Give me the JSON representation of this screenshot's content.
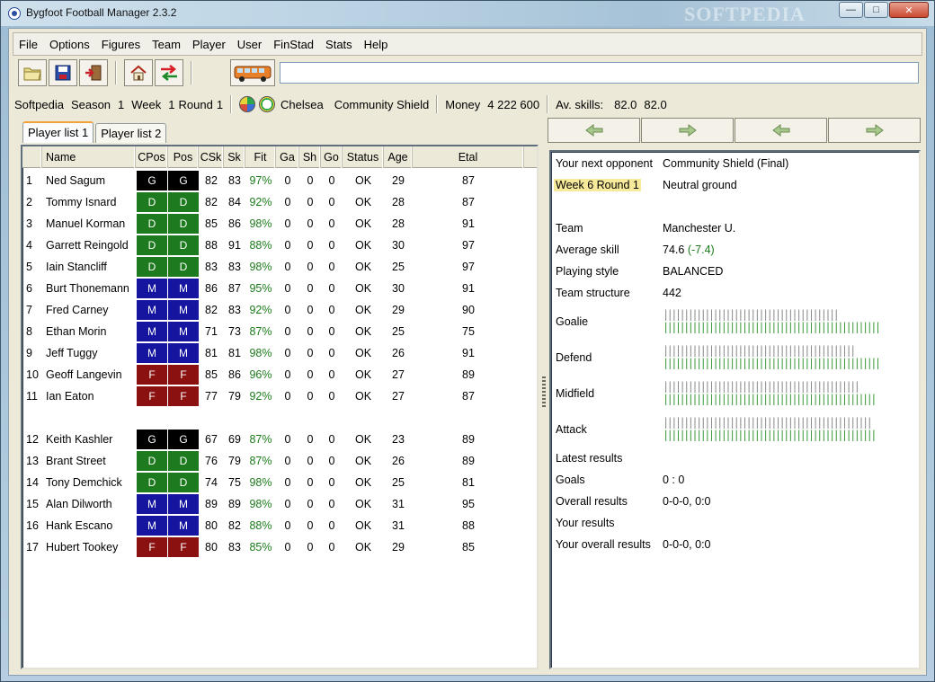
{
  "window": {
    "title": "Bygfoot Football Manager 2.3.2",
    "watermark": "SOFTPEDIA"
  },
  "menu": [
    "File",
    "Options",
    "Figures",
    "Team",
    "Player",
    "User",
    "FinStad",
    "Stats",
    "Help"
  ],
  "toolbar": {
    "icons": [
      "open-folder-icon",
      "save-disk-icon",
      "exit-door-icon",
      "home-icon",
      "transfer-arrows-icon",
      "bus-icon"
    ],
    "command_value": ""
  },
  "info": {
    "user": "Softpedia",
    "season_label": "Season",
    "season": "1",
    "week_label": "Week",
    "week": "1",
    "round_label": "Round",
    "round": "1",
    "team": "Chelsea",
    "competition": "Community Shield",
    "money_label": "Money",
    "money": "4 222 600",
    "avskills_label": "Av. skills:",
    "avskill1": "82.0",
    "avskill2": "82.0"
  },
  "tabs": [
    "Player list 1",
    "Player list 2"
  ],
  "columns": [
    "",
    "Name",
    "CPos",
    "Pos",
    "CSk",
    "Sk",
    "Fit",
    "Ga",
    "Sh",
    "Go",
    "Status",
    "Age",
    "Etal"
  ],
  "players": [
    {
      "n": "1",
      "name": "Ned Sagum",
      "cpos": "G",
      "pos": "G",
      "csk": "82",
      "sk": "83",
      "fit": "97%",
      "ga": "0",
      "sh": "0",
      "go": "0",
      "status": "OK",
      "age": "29",
      "etal": "87"
    },
    {
      "n": "2",
      "name": "Tommy Isnard",
      "cpos": "D",
      "pos": "D",
      "csk": "82",
      "sk": "84",
      "fit": "92%",
      "ga": "0",
      "sh": "0",
      "go": "0",
      "status": "OK",
      "age": "28",
      "etal": "87"
    },
    {
      "n": "3",
      "name": "Manuel Korman",
      "cpos": "D",
      "pos": "D",
      "csk": "85",
      "sk": "86",
      "fit": "98%",
      "ga": "0",
      "sh": "0",
      "go": "0",
      "status": "OK",
      "age": "28",
      "etal": "91"
    },
    {
      "n": "4",
      "name": "Garrett Reingold",
      "cpos": "D",
      "pos": "D",
      "csk": "88",
      "sk": "91",
      "fit": "88%",
      "ga": "0",
      "sh": "0",
      "go": "0",
      "status": "OK",
      "age": "30",
      "etal": "97"
    },
    {
      "n": "5",
      "name": "Iain Stancliff",
      "cpos": "D",
      "pos": "D",
      "csk": "83",
      "sk": "83",
      "fit": "98%",
      "ga": "0",
      "sh": "0",
      "go": "0",
      "status": "OK",
      "age": "25",
      "etal": "97"
    },
    {
      "n": "6",
      "name": "Burt Thonemann",
      "cpos": "M",
      "pos": "M",
      "csk": "86",
      "sk": "87",
      "fit": "95%",
      "ga": "0",
      "sh": "0",
      "go": "0",
      "status": "OK",
      "age": "30",
      "etal": "91"
    },
    {
      "n": "7",
      "name": "Fred Carney",
      "cpos": "M",
      "pos": "M",
      "csk": "82",
      "sk": "83",
      "fit": "92%",
      "ga": "0",
      "sh": "0",
      "go": "0",
      "status": "OK",
      "age": "29",
      "etal": "90"
    },
    {
      "n": "8",
      "name": "Ethan Morin",
      "cpos": "M",
      "pos": "M",
      "csk": "71",
      "sk": "73",
      "fit": "87%",
      "ga": "0",
      "sh": "0",
      "go": "0",
      "status": "OK",
      "age": "25",
      "etal": "75"
    },
    {
      "n": "9",
      "name": "Jeff Tuggy",
      "cpos": "M",
      "pos": "M",
      "csk": "81",
      "sk": "81",
      "fit": "98%",
      "ga": "0",
      "sh": "0",
      "go": "0",
      "status": "OK",
      "age": "26",
      "etal": "91"
    },
    {
      "n": "10",
      "name": "Geoff Langevin",
      "cpos": "F",
      "pos": "F",
      "csk": "85",
      "sk": "86",
      "fit": "96%",
      "ga": "0",
      "sh": "0",
      "go": "0",
      "status": "OK",
      "age": "27",
      "etal": "89"
    },
    {
      "n": "11",
      "name": "Ian Eaton",
      "cpos": "F",
      "pos": "F",
      "csk": "77",
      "sk": "79",
      "fit": "92%",
      "ga": "0",
      "sh": "0",
      "go": "0",
      "status": "OK",
      "age": "27",
      "etal": "87"
    },
    {
      "n": "12",
      "name": "Keith Kashler",
      "cpos": "G",
      "pos": "G",
      "csk": "67",
      "sk": "69",
      "fit": "87%",
      "ga": "0",
      "sh": "0",
      "go": "0",
      "status": "OK",
      "age": "23",
      "etal": "89"
    },
    {
      "n": "13",
      "name": "Brant Street",
      "cpos": "D",
      "pos": "D",
      "csk": "76",
      "sk": "79",
      "fit": "87%",
      "ga": "0",
      "sh": "0",
      "go": "0",
      "status": "OK",
      "age": "26",
      "etal": "89"
    },
    {
      "n": "14",
      "name": "Tony Demchick",
      "cpos": "D",
      "pos": "D",
      "csk": "74",
      "sk": "75",
      "fit": "98%",
      "ga": "0",
      "sh": "0",
      "go": "0",
      "status": "OK",
      "age": "25",
      "etal": "81"
    },
    {
      "n": "15",
      "name": "Alan Dilworth",
      "cpos": "M",
      "pos": "M",
      "csk": "89",
      "sk": "89",
      "fit": "98%",
      "ga": "0",
      "sh": "0",
      "go": "0",
      "status": "OK",
      "age": "31",
      "etal": "95"
    },
    {
      "n": "16",
      "name": "Hank Escano",
      "cpos": "M",
      "pos": "M",
      "csk": "80",
      "sk": "82",
      "fit": "88%",
      "ga": "0",
      "sh": "0",
      "go": "0",
      "status": "OK",
      "age": "31",
      "etal": "88"
    },
    {
      "n": "17",
      "name": "Hubert Tookey",
      "cpos": "F",
      "pos": "F",
      "csk": "80",
      "sk": "83",
      "fit": "85%",
      "ga": "0",
      "sh": "0",
      "go": "0",
      "status": "OK",
      "age": "29",
      "etal": "85"
    }
  ],
  "position_colors": {
    "G": "#000000",
    "D": "#1e7a1e",
    "M": "#1515a0",
    "F": "#8b1010"
  },
  "nav_icons": [
    "arrow-left-icon",
    "arrow-right-icon",
    "arrow-left-icon",
    "arrow-right-icon"
  ],
  "opponent": {
    "next_label": "Your next opponent",
    "next_value": "Community Shield (Final)",
    "week_round": "Week 6 Round 1",
    "venue": "Neutral ground",
    "team_label": "Team",
    "team": "Manchester U.",
    "avg_label": "Average skill",
    "avg_value": "74.6",
    "avg_diff": "(-7.4)",
    "style_label": "Playing style",
    "style": "BALANCED",
    "structure_label": "Team structure",
    "structure": "442",
    "goalie_label": "Goalie",
    "defend_label": "Defend",
    "midfield_label": "Midfield",
    "attack_label": "Attack",
    "latest_label": "Latest results",
    "goals_label": "Goals",
    "goals": "0 : 0",
    "overall_label": "Overall results",
    "overall": "0-0-0, 0:0",
    "yours_label": "Your results",
    "yours": "",
    "your_overall_label": "Your overall results",
    "your_overall": "0-0-0, 0:0"
  },
  "strength_bars": {
    "goalie": {
      "opponent": 0.81,
      "yours": 1.0
    },
    "defend": {
      "opponent": 0.89,
      "yours": 1.0
    },
    "midfield": {
      "opponent": 0.91,
      "yours": 0.98
    },
    "attack": {
      "opponent": 0.96,
      "yours": 0.98
    }
  }
}
